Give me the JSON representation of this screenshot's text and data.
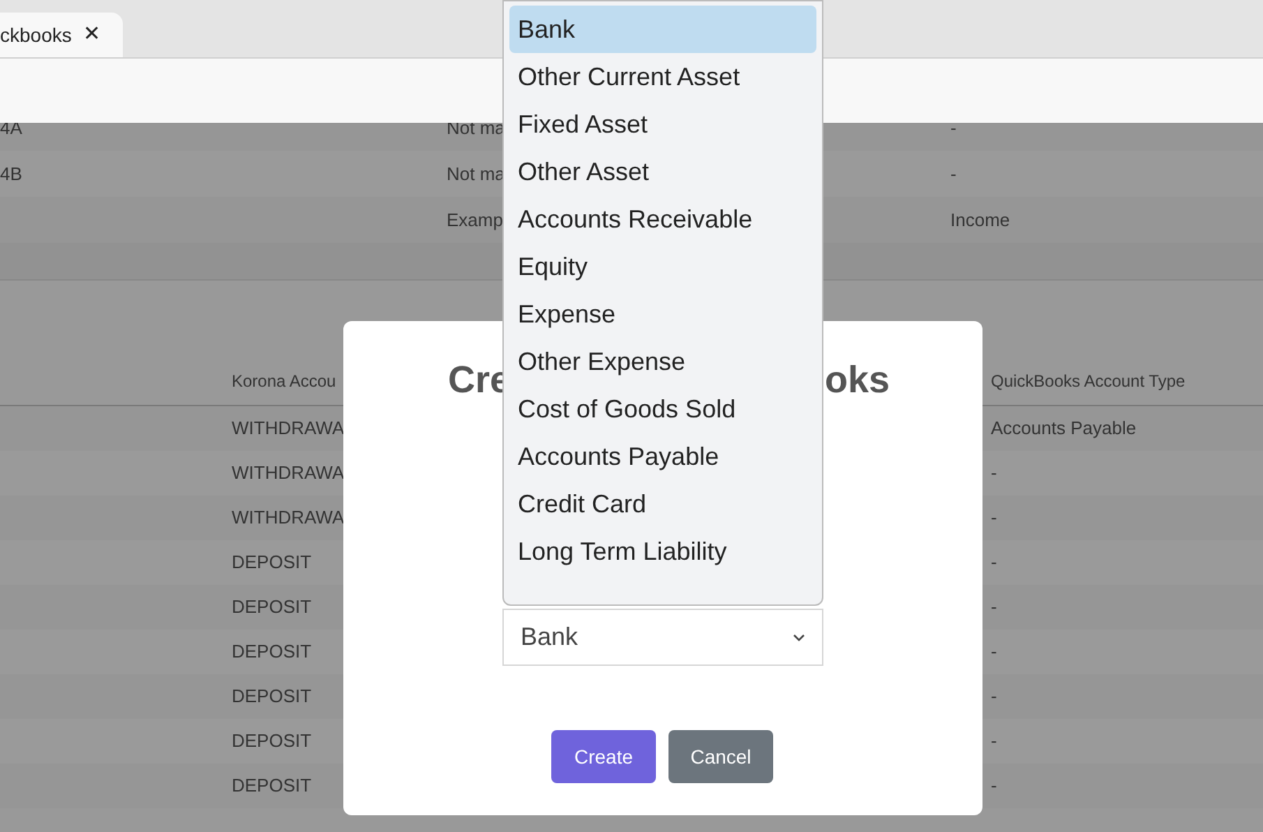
{
  "tab": {
    "label": "ckbooks",
    "close": "✕"
  },
  "top_table": {
    "rows": [
      {
        "column_1": "4A",
        "column_2": "Not ma",
        "column_3": "-"
      },
      {
        "column_1": "4B",
        "column_2": "Not ma",
        "column_3": "-"
      },
      {
        "column_2": "Examp",
        "column_3": "Income"
      }
    ]
  },
  "mapping_table": {
    "columns": [
      "Korona Accou",
      "QuickBooks Account Type"
    ],
    "rows": [
      {
        "column_1": "WITHDRAWA",
        "column_3": "Accounts Payable"
      },
      {
        "column_1": "WITHDRAWA",
        "column_3": "-"
      },
      {
        "column_1": "WITHDRAWA",
        "column_3": "-"
      },
      {
        "column_1": "DEPOSIT",
        "column_3": "-"
      },
      {
        "column_1": "DEPOSIT",
        "column_3": "-"
      },
      {
        "column_1": "DEPOSIT",
        "column_3": "-"
      },
      {
        "column_1": "DEPOSIT",
        "column_3": "-"
      },
      {
        "column_1": "DEPOSIT",
        "column_3": "-"
      },
      {
        "column_1": "DEPOSIT",
        "column_3": "-"
      }
    ]
  },
  "dialog": {
    "title_left": "Cre",
    "title_right": "oks",
    "account_type_select": {
      "value": "Bank"
    },
    "dropdown_options": [
      {
        "label": "Bank",
        "selected": true
      },
      {
        "label": "Other Current Asset",
        "selected": false
      },
      {
        "label": "Fixed Asset",
        "selected": false
      },
      {
        "label": "Other Asset",
        "selected": false
      },
      {
        "label": "Accounts Receivable",
        "selected": false
      },
      {
        "label": "Equity",
        "selected": false
      },
      {
        "label": "Expense",
        "selected": false
      },
      {
        "label": "Other Expense",
        "selected": false
      },
      {
        "label": "Cost of Goods Sold",
        "selected": false
      },
      {
        "label": "Accounts Payable",
        "selected": false
      },
      {
        "label": "Credit Card",
        "selected": false
      },
      {
        "label": "Long Term Liability",
        "selected": false
      }
    ],
    "buttons": [
      {
        "label": "Create",
        "kind": "primary"
      },
      {
        "label": "Cancel",
        "kind": "secondary"
      }
    ]
  }
}
